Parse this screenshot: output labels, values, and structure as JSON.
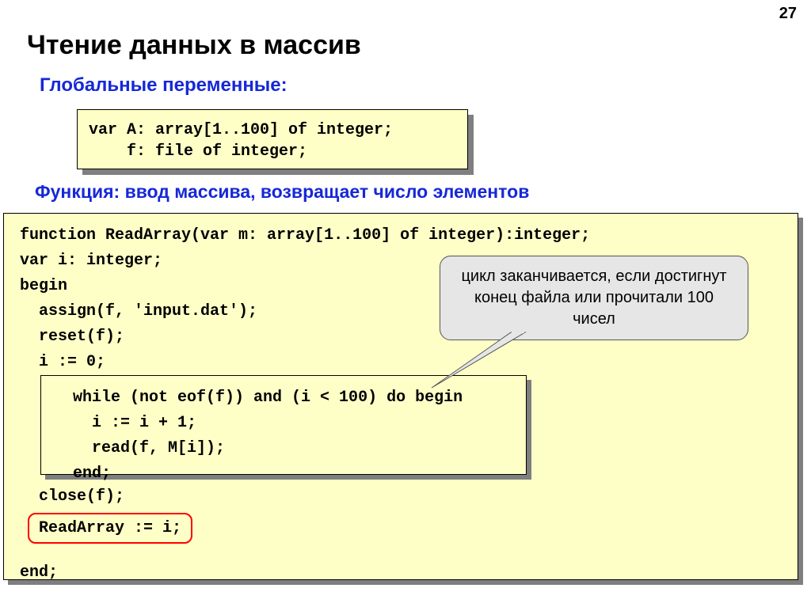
{
  "page_number": "27",
  "title": "Чтение данных в массив",
  "subtitle1": "Глобальные переменные:",
  "codebox1": "var A: array[1..100] of integer;\n    f: file of integer;",
  "subtitle2": "Функция: ввод массива, возвращает число элементов",
  "main": {
    "l1": "function ReadArray(var m: array[1..100] of integer):integer;",
    "l2": "var i: integer;",
    "l3": "begin",
    "l4": "  assign(f, 'input.dat');",
    "l5": "  reset(f);",
    "l6": "  i := 0;",
    "inner": "  while (not eof(f)) and (i < 100) do begin\n    i := i + 1;\n    read(f, M[i]);\n  end;",
    "close": "  close(f);",
    "readarr": "ReadArray := i;",
    "end": "end;"
  },
  "callout": "цикл заканчивается, если достигнут конец файла или прочитали 100 чисел"
}
